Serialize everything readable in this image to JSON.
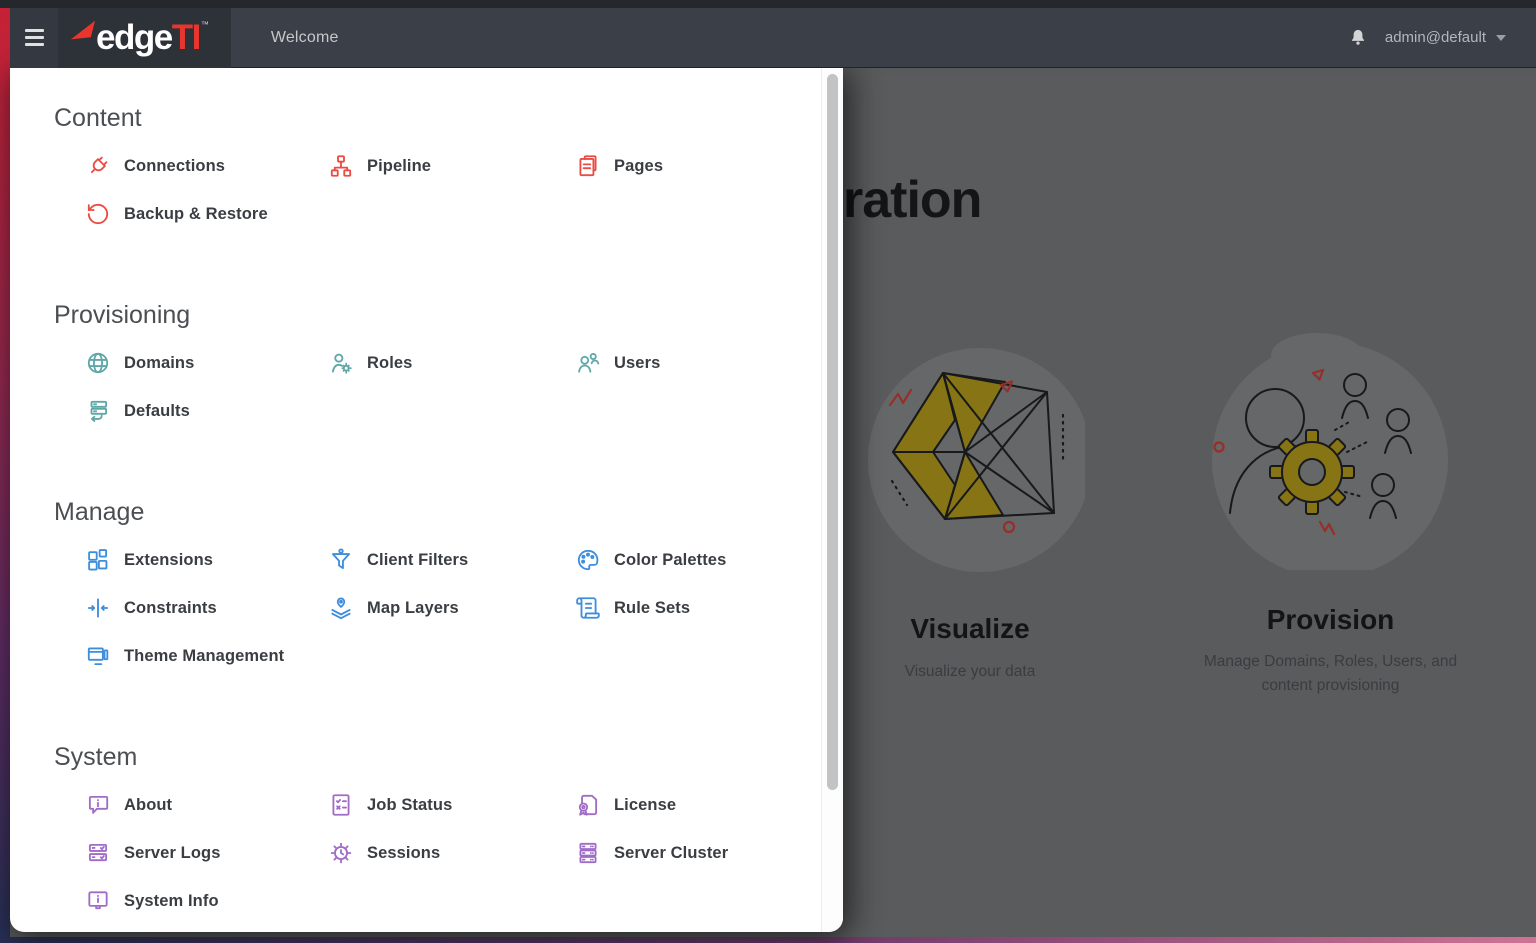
{
  "topbar": {
    "brand": {
      "word_white": "edge",
      "word_accent": "TI",
      "trademark": "™"
    },
    "page_label": "Welcome",
    "user_menu": {
      "username": "admin@default"
    },
    "icons": {
      "menu": "hamburger-icon",
      "notifications": "bell-icon",
      "user_caret": "chevron-down-icon"
    }
  },
  "drawer": {
    "sections": [
      {
        "title": "Content",
        "accent": "#ec4b44",
        "items": [
          {
            "label": "Connections",
            "icon": "plug-icon"
          },
          {
            "label": "Pipeline",
            "icon": "org-chart-icon"
          },
          {
            "label": "Pages",
            "icon": "pages-icon"
          },
          {
            "label": "Backup & Restore",
            "icon": "restore-arrow-icon"
          }
        ]
      },
      {
        "title": "Provisioning",
        "accent": "#5fa7a8",
        "items": [
          {
            "label": "Domains",
            "icon": "globe-icon"
          },
          {
            "label": "Roles",
            "icon": "user-gear-icon"
          },
          {
            "label": "Users",
            "icon": "users-icon"
          },
          {
            "label": "Defaults",
            "icon": "server-restore-icon"
          }
        ]
      },
      {
        "title": "Manage",
        "accent": "#3d8edd",
        "items": [
          {
            "label": "Extensions",
            "icon": "blocks-icon"
          },
          {
            "label": "Client Filters",
            "icon": "funnel-user-icon"
          },
          {
            "label": "Color Palettes",
            "icon": "palette-icon"
          },
          {
            "label": "Constraints",
            "icon": "constraints-icon"
          },
          {
            "label": "Map Layers",
            "icon": "map-layers-icon"
          },
          {
            "label": "Rule Sets",
            "icon": "scroll-icon"
          },
          {
            "label": "Theme Management",
            "icon": "theme-windows-icon"
          }
        ]
      },
      {
        "title": "System",
        "accent": "#a06cc8",
        "items": [
          {
            "label": "About",
            "icon": "speech-info-icon"
          },
          {
            "label": "Job Status",
            "icon": "task-list-icon"
          },
          {
            "label": "License",
            "icon": "certificate-icon"
          },
          {
            "label": "Server Logs",
            "icon": "server-check-icon"
          },
          {
            "label": "Sessions",
            "icon": "gear-clock-icon"
          },
          {
            "label": "Server Cluster",
            "icon": "server-stack-icon"
          },
          {
            "label": "System Info",
            "icon": "monitor-info-icon"
          }
        ]
      }
    ]
  },
  "background_page": {
    "title_visible_fragment": "ration",
    "cards": [
      {
        "title": "Visualize",
        "subtitle": "Visualize your data"
      },
      {
        "title": "Provision",
        "subtitle": "Manage Domains, Roles, Users, and content provisioning"
      }
    ]
  },
  "colors": {
    "brand_red": "#e8352e",
    "topbar": "#3b3f47",
    "content_accent": "#ec4b44",
    "provisioning_accent": "#5fa7a8",
    "manage_accent": "#3d8edd",
    "system_accent": "#a06cc8",
    "illustration_gold": "#877415",
    "dim_background": "#595b5c"
  }
}
